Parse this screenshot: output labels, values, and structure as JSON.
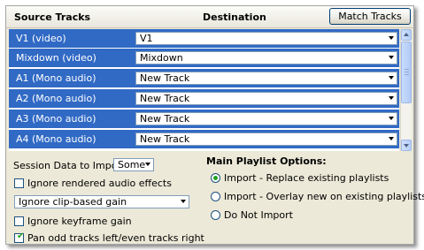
{
  "header": {
    "source_label": "Source Tracks",
    "destination_label": "Destination",
    "match_button_label": "Match Tracks"
  },
  "tracks": [
    {
      "source": "V1 (video)",
      "destination": "V1"
    },
    {
      "source": "Mixdown (video)",
      "destination": "Mixdown"
    },
    {
      "source": "A1 (Mono audio)",
      "destination": "New Track"
    },
    {
      "source": "A2 (Mono audio)",
      "destination": "New Track"
    },
    {
      "source": "A3 (Mono audio)",
      "destination": "New Track"
    },
    {
      "source": "A4 (Mono audio)",
      "destination": "New Track"
    }
  ],
  "session_data": {
    "label": "Session Data to Import:",
    "selected": "Some"
  },
  "options": {
    "ignore_rendered_audio": {
      "label": "Ignore rendered audio effects",
      "checked": false
    },
    "clip_gain_select": "Ignore clip-based gain",
    "ignore_keyframe_gain": {
      "label": "Ignore keyframe gain",
      "checked": false
    },
    "pan_tracks": {
      "label": "Pan odd tracks left/even tracks right",
      "checked": true
    }
  },
  "playlist": {
    "title": "Main Playlist Options:",
    "options": [
      {
        "label": "Import - Replace existing playlists",
        "selected": true
      },
      {
        "label": "Import - Overlay new on existing playlists",
        "selected": false
      },
      {
        "label": "Do Not Import",
        "selected": false
      }
    ]
  },
  "colors": {
    "selection": "#316ac5",
    "panel": "#ece9d8",
    "accent_check": "#21a121"
  }
}
